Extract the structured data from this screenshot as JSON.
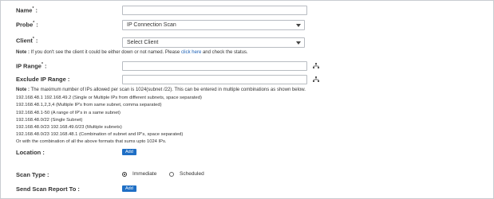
{
  "form": {
    "name_label": "Name",
    "probe_label": "Probe",
    "probe_value": "IP Connection Scan",
    "client_label": "Client",
    "client_value": "Select Client",
    "client_note": {
      "prefix": "Note :",
      "text": " If you don't see the client it could be either down or not named. Please ",
      "link": "click here",
      "suffix": " and check the status."
    },
    "ip_range_label": "IP Range",
    "exclude_label": "Exclude IP Range :",
    "ip_note": {
      "prefix": "Note :",
      "text": " The maximum number of IPs allowed per scan is 1024(subnet /22). This can be entered in multiple combinations as shown below."
    },
    "examples": [
      "192.168.48.1 192.168.49.2 (Single or Multiple IPs from different subnets, space separated)",
      "192.168.48.1,2,3,4 (Multiple IP's from same subnet, comma separated)",
      "192.168.48.1-50 (A range of IP's in a same subnet)",
      "192.168.48.0/22 (Single Subnet)",
      "192.168.48.0/23 192.168.49.0/23 (Multiple subnets)",
      "192.168.48.0/23 192.168.48.1 (Combination of subnet and IP's, space separated)",
      "Or with the combination of all the above formats that sums upto 1024 IPs."
    ],
    "location_label": "Location :",
    "add_label": "Add",
    "scan_type_label": "Scan Type :",
    "scan_options": [
      "Immediate",
      "Scheduled"
    ],
    "scan_selected": "Immediate",
    "report_label": "Send Scan Report To :",
    "required_mark": "*",
    "colon": " :"
  }
}
